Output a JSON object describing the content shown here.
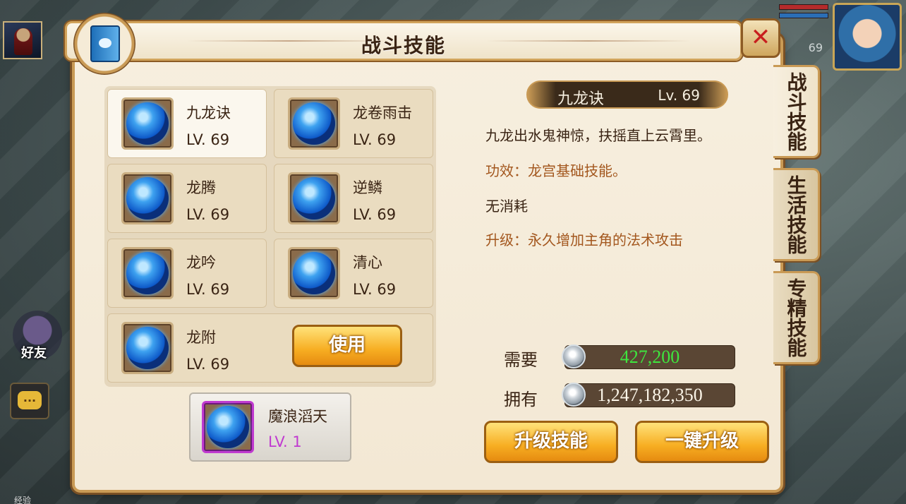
{
  "window": {
    "title": "战斗技能"
  },
  "hud": {
    "level": "69",
    "friend_label": "好友",
    "chat_icon": "...",
    "exp_label": "经验"
  },
  "tabs": [
    {
      "label": "战斗技能",
      "active": true
    },
    {
      "label": "生活技能",
      "active": false
    },
    {
      "label": "专精技能",
      "active": false
    }
  ],
  "skills": [
    {
      "name": "九龙诀",
      "level": "LV. 69",
      "selected": true
    },
    {
      "name": "龙卷雨击",
      "level": "LV. 69"
    },
    {
      "name": "龙腾",
      "level": "LV. 69"
    },
    {
      "name": "逆鳞",
      "level": "LV. 69"
    },
    {
      "name": "龙吟",
      "level": "LV. 69"
    },
    {
      "name": "清心",
      "level": "LV. 69"
    },
    {
      "name": "龙附",
      "level": "LV. 69"
    }
  ],
  "use_button": "使用",
  "special_skill": {
    "name": "魔浪滔天",
    "level": "LV. 1"
  },
  "detail": {
    "name": "九龙诀",
    "level": "Lv. 69",
    "description": "九龙出水鬼神惊，扶摇直上云霄里。",
    "effect": "功效：龙宫基础技能。",
    "cost": "无消耗",
    "upgrade": "升级：永久增加主角的法术攻击"
  },
  "currency": {
    "need_label": "需要",
    "need_value": "427,200",
    "own_label": "拥有",
    "own_value": "1,247,182,350"
  },
  "buttons": {
    "upgrade": "升级技能",
    "upgrade_all": "一键升级"
  },
  "icons": {
    "close": "close-icon",
    "book": "skill-book-icon",
    "coin": "silver-coin-icon"
  },
  "colors": {
    "need_value": "#3ee63e",
    "effect_text": "#a3571e",
    "special_level": "#c03ad0"
  }
}
